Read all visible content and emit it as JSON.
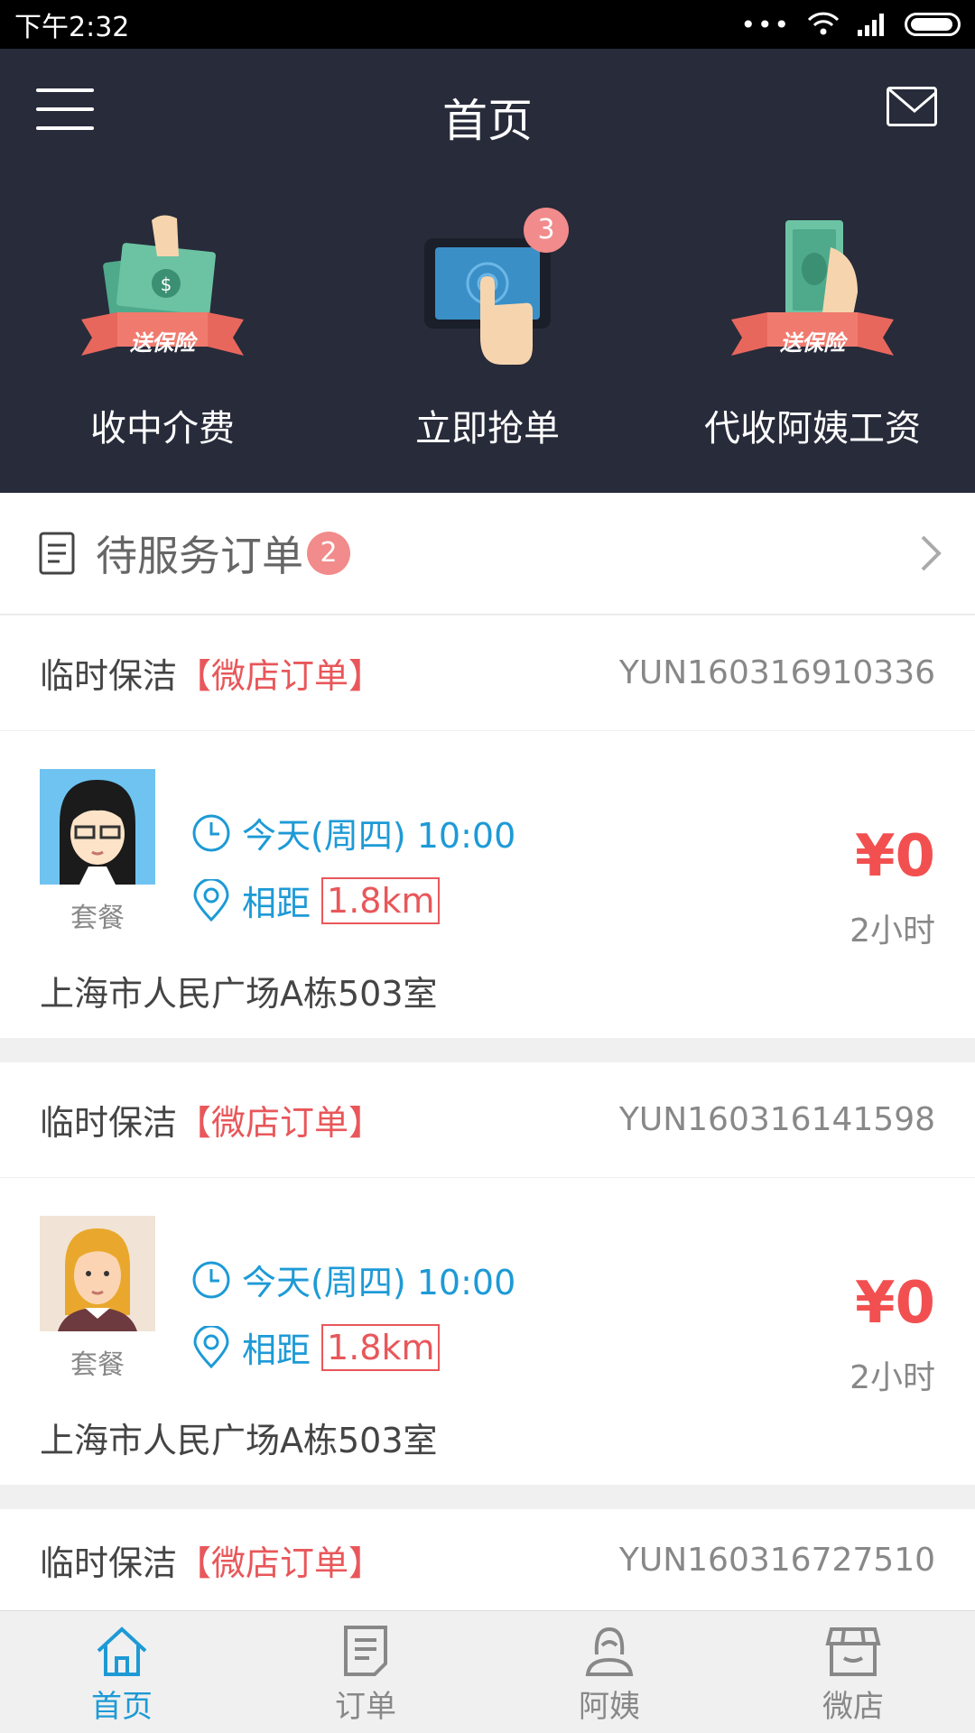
{
  "status_bar": {
    "time": "下午2:32",
    "dots": "•••"
  },
  "header": {
    "title": "首页",
    "features": [
      {
        "label": "收中介费",
        "ribbon": "送保险"
      },
      {
        "label": "立即抢单",
        "badge": "3"
      },
      {
        "label": "代收阿姨工资",
        "ribbon": "送保险"
      }
    ]
  },
  "pending": {
    "title": "待服务订单",
    "badge": "2"
  },
  "orders": [
    {
      "type": "临时保洁",
      "tag": "【微店订单】",
      "order_no": "YUN160316910336",
      "avatar_label": "套餐",
      "time": "今天(周四) 10:00",
      "distance_label": "相距",
      "distance": "1.8km",
      "price": "¥0",
      "duration": "2小时",
      "address": "上海市人民广场A栋503室"
    },
    {
      "type": "临时保洁",
      "tag": "【微店订单】",
      "order_no": "YUN160316141598",
      "avatar_label": "套餐",
      "time": "今天(周四) 10:00",
      "distance_label": "相距",
      "distance": "1.8km",
      "price": "¥0",
      "duration": "2小时",
      "address": "上海市人民广场A栋503室"
    },
    {
      "type": "临时保洁",
      "tag": "【微店订单】",
      "order_no": "YUN160316727510"
    }
  ],
  "tabbar": {
    "items": [
      {
        "label": "首页",
        "icon": "home-icon",
        "active": true
      },
      {
        "label": "订单",
        "icon": "order-icon",
        "active": false
      },
      {
        "label": "阿姨",
        "icon": "nanny-icon",
        "active": false
      },
      {
        "label": "微店",
        "icon": "shop-icon",
        "active": false
      }
    ]
  },
  "colors": {
    "header_bg": "#272b3a",
    "accent_blue": "#1d9ad6",
    "accent_red": "#e8575a",
    "badge": "#f28b8b"
  }
}
